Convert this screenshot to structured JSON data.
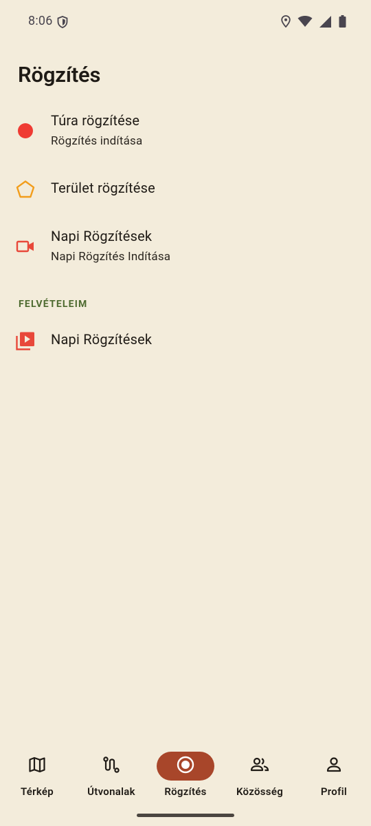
{
  "status_bar": {
    "time": "8:06",
    "icons": [
      "shield-icon",
      "location-icon",
      "wifi-icon",
      "signal-icon",
      "battery-icon"
    ]
  },
  "page": {
    "title": "Rögzítés"
  },
  "items": [
    {
      "title": "Túra rögzítése",
      "subtitle": "Rögzítés indítása",
      "icon": "record-dot-icon",
      "icon_color": "#ef3b33"
    },
    {
      "title": "Terület rögzítése",
      "icon": "pentagon-icon",
      "icon_color": "#f29d1b"
    },
    {
      "title": "Napi Rögzítések",
      "subtitle": "Napi Rögzítés Indítása",
      "icon": "video-camera-icon",
      "icon_color": "#e8483a"
    }
  ],
  "section": {
    "header": "FELVÉTELEIM",
    "items": [
      {
        "title": "Napi Rögzítések",
        "icon": "video-library-icon",
        "icon_color": "#e8483a"
      }
    ]
  },
  "bottom_nav": {
    "items": [
      {
        "label": "Térkép",
        "icon": "map-icon",
        "active": false
      },
      {
        "label": "Útvonalak",
        "icon": "route-icon",
        "active": false
      },
      {
        "label": "Rögzítés",
        "icon": "record-icon",
        "active": true
      },
      {
        "label": "Közösség",
        "icon": "people-icon",
        "active": false
      },
      {
        "label": "Profil",
        "icon": "person-icon",
        "active": false
      }
    ],
    "active_color": "#a8462a"
  }
}
